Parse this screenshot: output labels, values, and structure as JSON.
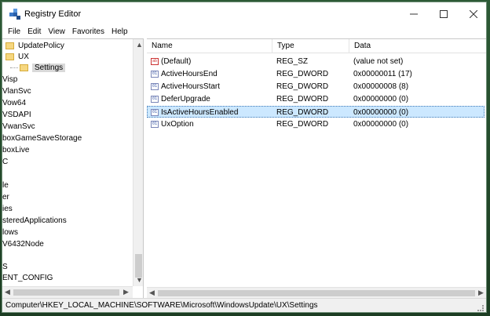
{
  "window": {
    "title": "Registry Editor"
  },
  "menu": [
    "File",
    "Edit",
    "View",
    "Favorites",
    "Help"
  ],
  "tree": {
    "items": [
      "UpdatePolicy",
      "UX",
      "Settings",
      "Visp",
      "VlanSvc",
      "Vow64",
      "VSDAPI",
      "VwanSvc",
      "boxGameSaveStorage",
      "boxLive",
      "C",
      "",
      "le",
      "er",
      "ies",
      "steredApplications",
      "lows",
      "V6432Node",
      "",
      "S",
      "ENT_CONFIG"
    ]
  },
  "list": {
    "columns": [
      "Name",
      "Type",
      "Data"
    ],
    "rows": [
      {
        "name": "(Default)",
        "type": "REG_SZ",
        "data": "(value not set)",
        "icon": "string-value-icon"
      },
      {
        "name": "ActiveHoursEnd",
        "type": "REG_DWORD",
        "data": "0x00000011 (17)",
        "icon": "dword-value-icon"
      },
      {
        "name": "ActiveHoursStart",
        "type": "REG_DWORD",
        "data": "0x00000008 (8)",
        "icon": "dword-value-icon"
      },
      {
        "name": "DeferUpgrade",
        "type": "REG_DWORD",
        "data": "0x00000000 (0)",
        "icon": "dword-value-icon"
      },
      {
        "name": "IsActiveHoursEnabled",
        "type": "REG_DWORD",
        "data": "0x00000000 (0)",
        "icon": "dword-value-icon"
      },
      {
        "name": "UxOption",
        "type": "REG_DWORD",
        "data": "0x00000000 (0)",
        "icon": "dword-value-icon"
      }
    ],
    "selected_index": 4
  },
  "statusbar": {
    "path": "Computer\\HKEY_LOCAL_MACHINE\\SOFTWARE\\Microsoft\\WindowsUpdate\\UX\\Settings"
  },
  "colors": {
    "selection": "#cce8ff",
    "tree_selection": "#d9d9d9",
    "folder": "#f6d77f"
  }
}
